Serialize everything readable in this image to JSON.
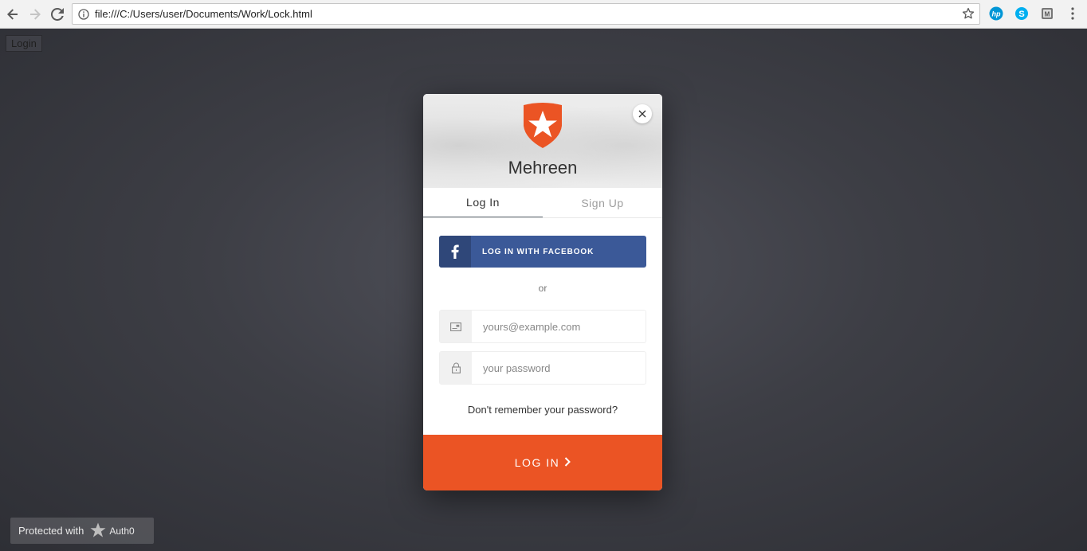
{
  "browser": {
    "url": "file:///C:/Users/user/Documents/Work/Lock.html"
  },
  "page": {
    "login_button": "Login"
  },
  "lock": {
    "title": "Mehreen",
    "tabs": [
      {
        "label": "Log In",
        "active": true
      },
      {
        "label": "Sign Up",
        "active": false
      }
    ],
    "facebook_button": "LOG IN WITH FACEBOOK",
    "separator": "or",
    "email_placeholder": "yours@example.com",
    "password_placeholder": "your password",
    "forgot_link": "Don't remember your password?",
    "submit_label": "LOG IN",
    "accent_color": "#eb5424",
    "facebook_color": "#3b5998"
  },
  "footer_badge": {
    "text": "Protected with",
    "brand": "Auth0"
  }
}
